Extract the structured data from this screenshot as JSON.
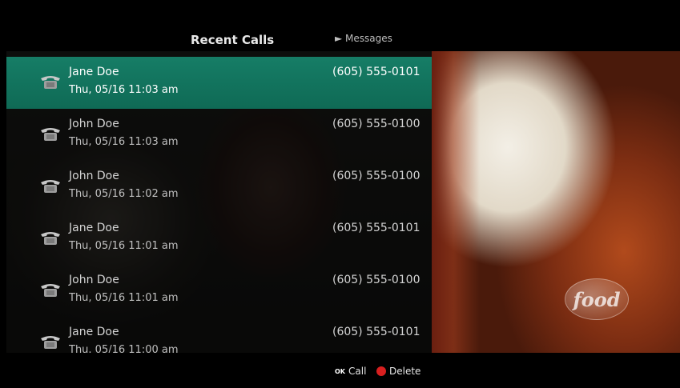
{
  "header": {
    "title": "Recent Calls",
    "messages_link": "► Messages"
  },
  "calls": [
    {
      "name": "Jane Doe",
      "time": "Thu, 05/16 11:03 am",
      "number": "(605) 555-0101",
      "selected": true
    },
    {
      "name": "John Doe",
      "time": "Thu, 05/16 11:03 am",
      "number": "(605) 555-0100",
      "selected": false
    },
    {
      "name": "John Doe",
      "time": "Thu, 05/16 11:02 am",
      "number": "(605) 555-0100",
      "selected": false
    },
    {
      "name": "Jane Doe",
      "time": "Thu, 05/16 11:01 am",
      "number": "(605) 555-0101",
      "selected": false
    },
    {
      "name": "John Doe",
      "time": "Thu, 05/16 11:01 am",
      "number": "(605) 555-0100",
      "selected": false
    },
    {
      "name": "Jane Doe",
      "time": "Thu. 05/16 11:00 am",
      "number": "(605) 555-0101",
      "selected": false
    }
  ],
  "footer": {
    "ok_key": "OK",
    "call_label": "Call",
    "delete_label": "Delete"
  },
  "video": {
    "channel_logo": "food"
  },
  "colors": {
    "selected_row": "#167d66",
    "delete_key": "#d81f1f"
  },
  "icons": {
    "row_icon": "desk-phone-icon",
    "delete_icon": "red-button-icon"
  }
}
